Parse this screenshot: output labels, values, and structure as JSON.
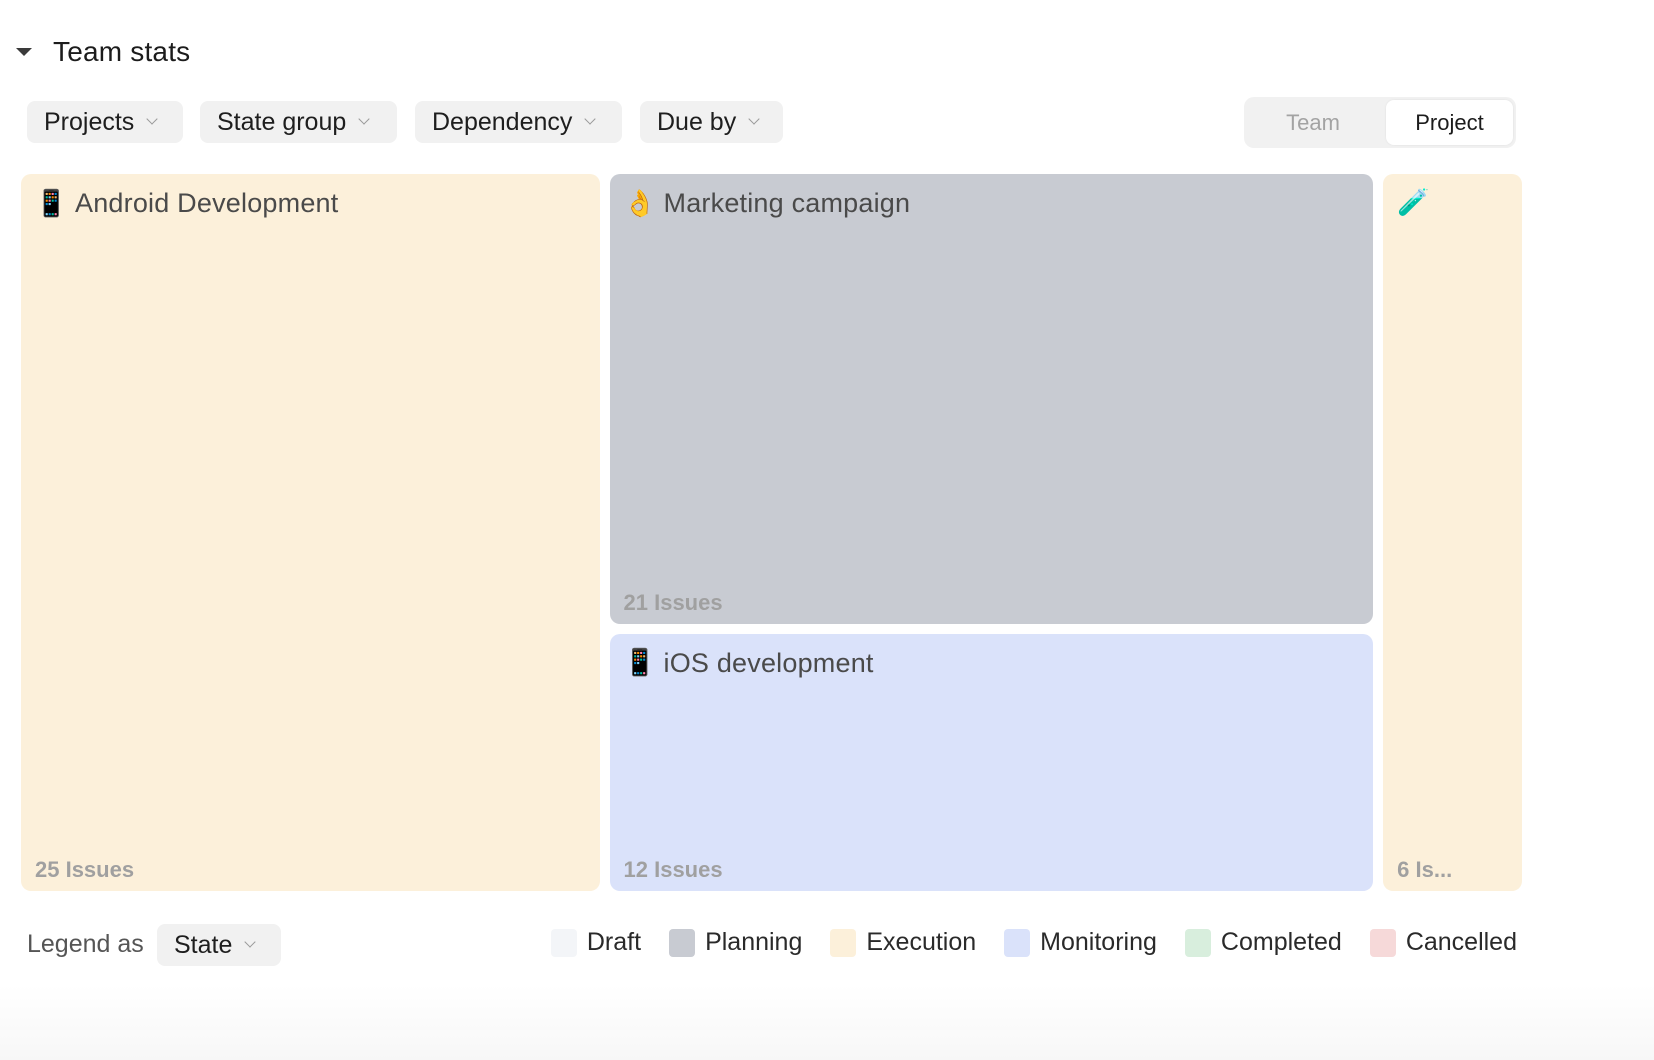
{
  "section": {
    "title": "Team stats",
    "collapse_icon": "caret-down-icon"
  },
  "filters": [
    {
      "label": "Projects"
    },
    {
      "label": "State group"
    },
    {
      "label": "Dependency"
    },
    {
      "label": "Due by"
    }
  ],
  "view_toggle": {
    "options": [
      "Team",
      "Project"
    ],
    "selected": "Project"
  },
  "legend_as": {
    "label": "Legend as",
    "selected": "State"
  },
  "colors": {
    "Draft": "#f3f5f8",
    "Planning": "#c8cbd2",
    "Execution": "#fcf0da",
    "Monitoring": "#dae2fa",
    "Completed": "#d8eedd",
    "Cancelled": "#f6d9d9"
  },
  "chart_data": {
    "type": "treemap",
    "title": "Team stats",
    "value_label": "Issues",
    "color_by": "State",
    "items": [
      {
        "name": "Android Development",
        "icon": "📱",
        "icon_name": "mobile-phone-icon",
        "value": 25,
        "label": "25 Issues",
        "state": "Execution"
      },
      {
        "name": "Marketing campaign",
        "icon": "👌",
        "icon_name": "ok-hand-icon",
        "value": 21,
        "label": "21 Issues",
        "state": "Planning"
      },
      {
        "name": "iOS development",
        "icon": "📱",
        "icon_name": "mobile-phone-icon",
        "value": 12,
        "label": "12 Issues",
        "state": "Monitoring"
      },
      {
        "name": "",
        "icon": "🧪",
        "icon_name": "test-tube-icon",
        "value": 6,
        "label": "6 Is...",
        "state": "Execution"
      }
    ],
    "legend": [
      "Draft",
      "Planning",
      "Execution",
      "Monitoring",
      "Completed",
      "Cancelled"
    ],
    "legend_placement": "bottom-right"
  }
}
